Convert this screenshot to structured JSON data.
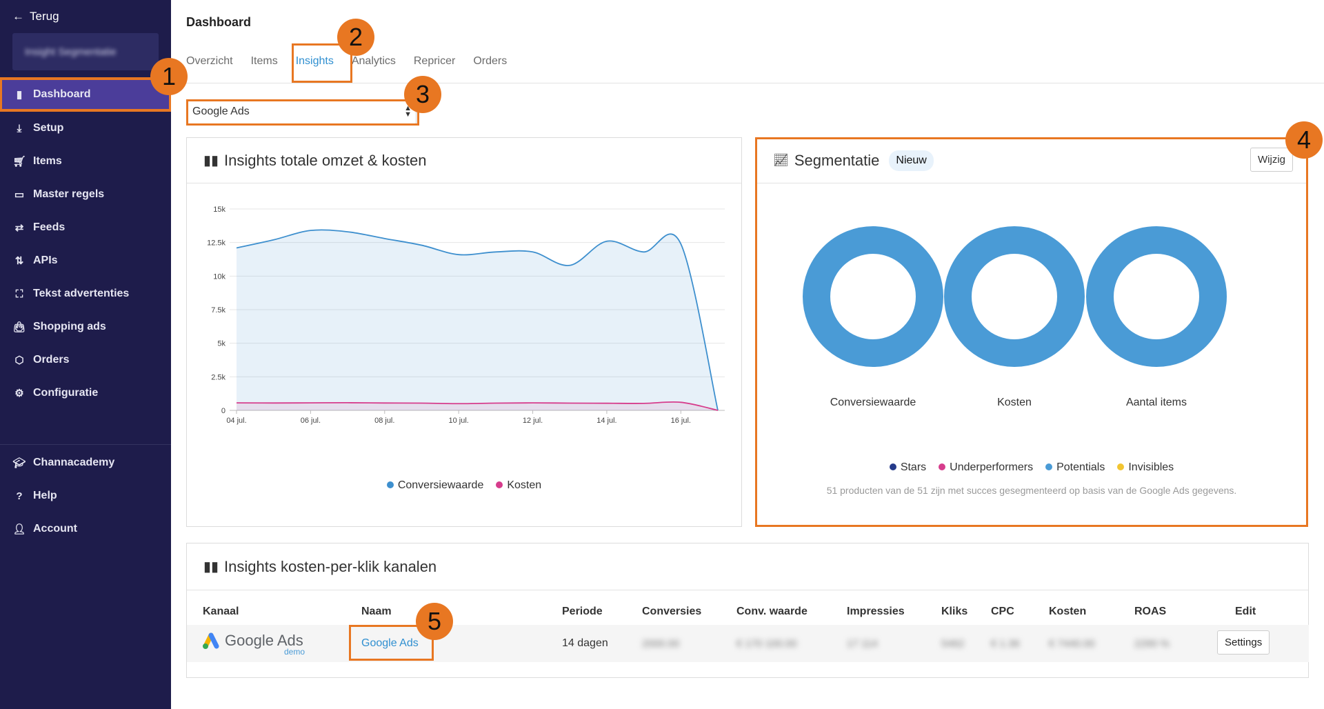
{
  "sidebar": {
    "back_label": "Terug",
    "workspace_label": "Insight Segmentatie",
    "items": [
      {
        "label": "Dashboard",
        "icon": "bar-chart-icon"
      },
      {
        "label": "Setup",
        "icon": "download-tray-icon"
      },
      {
        "label": "Items",
        "icon": "cart-icon"
      },
      {
        "label": "Master regels",
        "icon": "clipboard-icon"
      },
      {
        "label": "Feeds",
        "icon": "swap-arrows-icon"
      },
      {
        "label": "APIs",
        "icon": "sort-arrows-icon"
      },
      {
        "label": "Tekst advertenties",
        "icon": "frame-icon"
      },
      {
        "label": "Shopping ads",
        "icon": "bag-icon"
      },
      {
        "label": "Orders",
        "icon": "box-icon"
      },
      {
        "label": "Configuratie",
        "icon": "gear-icon"
      }
    ],
    "bottom_items": [
      {
        "label": "Channacademy",
        "icon": "graduation-cap-icon"
      },
      {
        "label": "Help",
        "icon": "question-circle-icon"
      },
      {
        "label": "Account",
        "icon": "user-icon"
      }
    ]
  },
  "header": {
    "title": "Dashboard",
    "tabs": [
      "Overzicht",
      "Items",
      "Insights",
      "Analytics",
      "Repricer",
      "Orders"
    ],
    "active_tab": "Insights"
  },
  "channel_select": {
    "value": "Google Ads"
  },
  "callouts": [
    "1",
    "2",
    "3",
    "4",
    "5"
  ],
  "omzet_card": {
    "title": "Insights totale omzet & kosten"
  },
  "chart_data": {
    "type": "area",
    "x": [
      "04 jul.",
      "05 jul.",
      "06 jul.",
      "07 jul.",
      "08 jul.",
      "09 jul.",
      "10 jul.",
      "11 jul.",
      "12 jul.",
      "13 jul.",
      "14 jul.",
      "15 jul.",
      "16 jul.",
      "17 jul."
    ],
    "x_tick_labels": [
      "04 jul.",
      "06 jul.",
      "08 jul.",
      "10 jul.",
      "12 jul.",
      "14 jul.",
      "16 jul."
    ],
    "y_tick_labels": [
      "0",
      "2.5k",
      "5k",
      "7.5k",
      "10k",
      "12.5k",
      "15k"
    ],
    "ylim": [
      0,
      15000
    ],
    "series": [
      {
        "name": "Conversiewaarde",
        "color": "#3d8fce",
        "values": [
          12100,
          12700,
          13400,
          13300,
          12800,
          12300,
          11600,
          11800,
          11800,
          10800,
          12600,
          11800,
          12400,
          0
        ]
      },
      {
        "name": "Kosten",
        "color": "#d63c8c",
        "values": [
          560,
          550,
          560,
          570,
          550,
          540,
          500,
          540,
          560,
          540,
          530,
          520,
          600,
          0
        ]
      }
    ],
    "legend_position": "bottom",
    "grid": true
  },
  "segment_card": {
    "title": "Segmentatie",
    "badge": "Nieuw",
    "edit_label": "Wijzig",
    "donuts": [
      "Conversiewaarde",
      "Kosten",
      "Aantal items"
    ],
    "legend": [
      {
        "name": "Stars",
        "color": "#253a8a"
      },
      {
        "name": "Underperformers",
        "color": "#d63c8c"
      },
      {
        "name": "Potentials",
        "color": "#4a9bd6"
      },
      {
        "name": "Invisibles",
        "color": "#f2c531"
      }
    ],
    "note": "51 producten van de 51 zijn met succes gesegmenteerd op basis van de Google Ads gegevens.",
    "donut_color": "#4a9bd6"
  },
  "cpc_card": {
    "title": "Insights kosten-per-klik kanalen",
    "columns": [
      "Kanaal",
      "Naam",
      "Periode",
      "Conversies",
      "Conv. waarde",
      "Impressies",
      "Kliks",
      "CPC",
      "Kosten",
      "ROAS",
      "Edit"
    ],
    "row": {
      "kanaal_logo": "Google Ads",
      "kanaal_sub": "demo",
      "naam": "Google Ads",
      "periode": "14 dagen",
      "conversies": "2000.00",
      "conv_waarde": "€ 170 100.00",
      "impressies": "17 114",
      "kliks": "5462",
      "cpc": "€ 1.36",
      "kosten": "€ 7440.00",
      "roas": "2290 %",
      "edit": "Settings"
    }
  }
}
